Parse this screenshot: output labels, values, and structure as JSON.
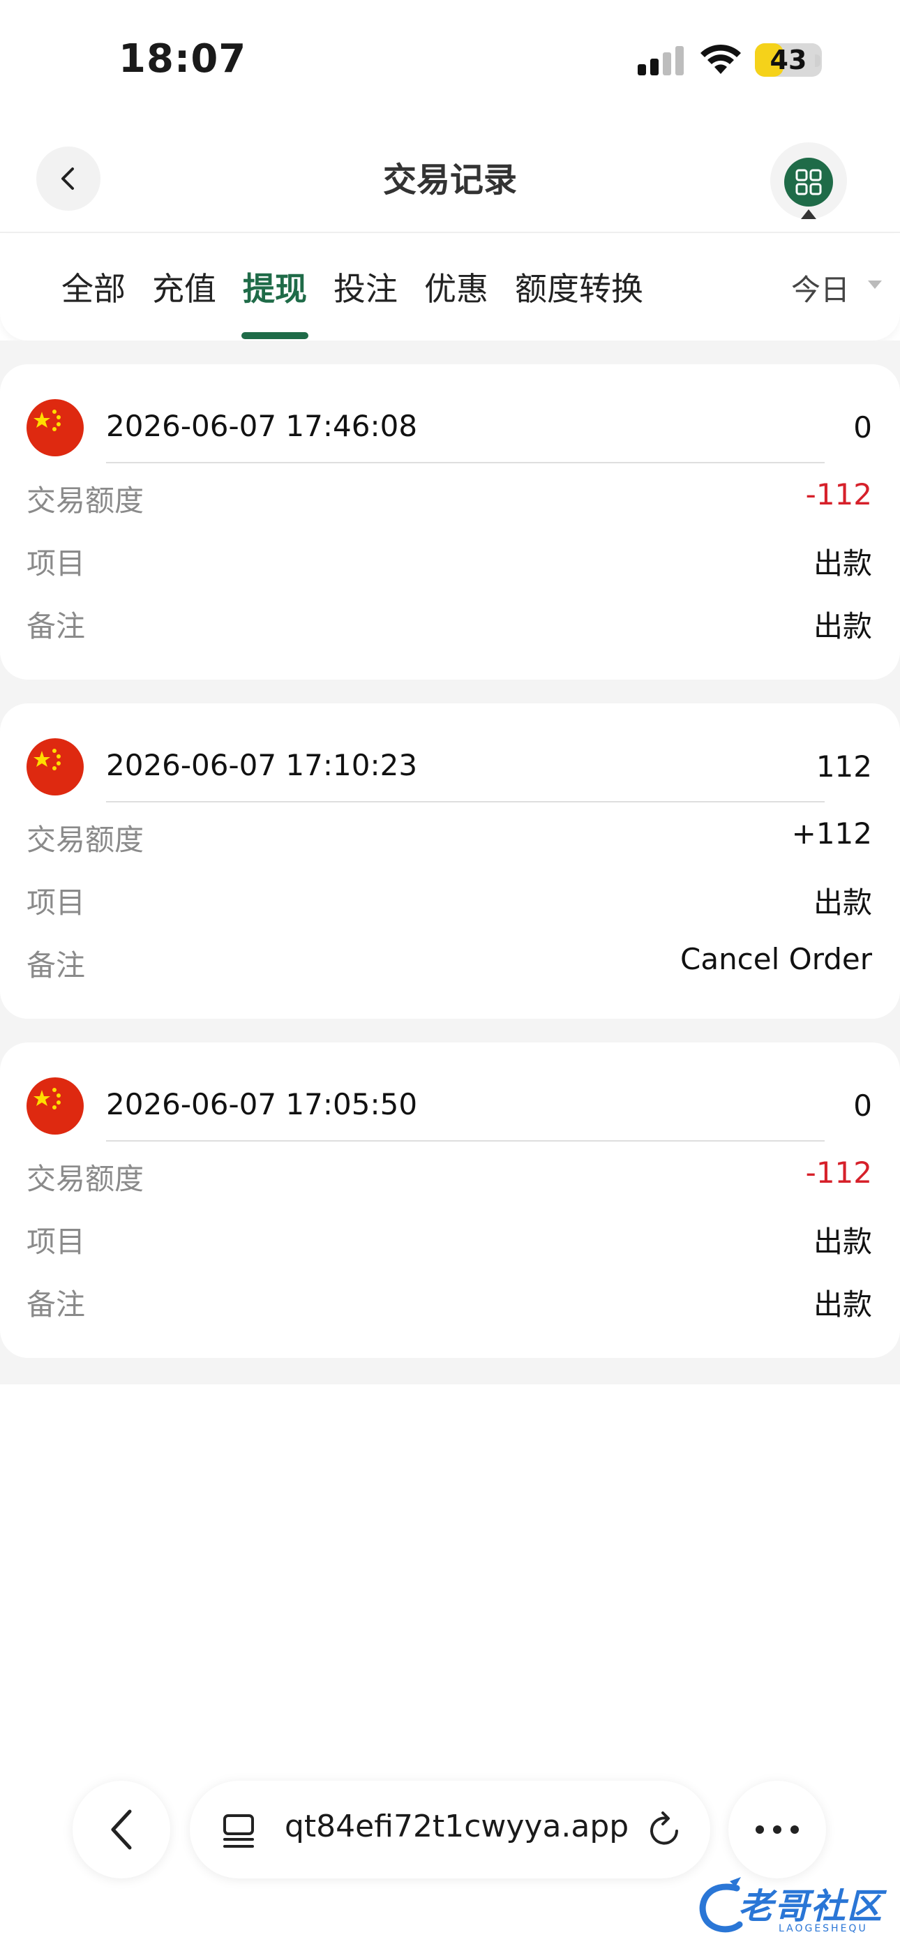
{
  "status_bar": {
    "time": "18:07",
    "battery": "43",
    "battery_level_percent": 43
  },
  "header": {
    "title": "交易记录",
    "back_icon": "chevron-left-icon",
    "menu_icon": "grid-icon"
  },
  "tabs": {
    "items": [
      {
        "label": "全部"
      },
      {
        "label": "充值"
      },
      {
        "label": "提现"
      },
      {
        "label": "投注"
      },
      {
        "label": "优惠"
      },
      {
        "label": "额度转换"
      }
    ],
    "active_index": 2,
    "date_filter": "今日"
  },
  "colors": {
    "accent": "#1f6b48",
    "negative": "#d6202a",
    "label_gray": "#8a8a8a"
  },
  "records": [
    {
      "time": "2026-06-07 17:46:08",
      "balance": "0",
      "amount_label": "交易额度",
      "amount": "-112",
      "item_label": "项目",
      "item": "出款",
      "note_label": "备注",
      "note": "出款"
    },
    {
      "time": "2026-06-07 17:10:23",
      "balance": "112",
      "amount_label": "交易额度",
      "amount": "+112",
      "item_label": "项目",
      "item": "出款",
      "note_label": "备注",
      "note": "Cancel Order"
    },
    {
      "time": "2026-06-07 17:05:50",
      "balance": "0",
      "amount_label": "交易额度",
      "amount": "-112",
      "item_label": "项目",
      "item": "出款",
      "note_label": "备注",
      "note": "出款"
    }
  ],
  "browser": {
    "url": "qt84efi72t1cwyya.app",
    "back_icon": "chevron-left-icon",
    "tabs_icon": "tabs-icon",
    "reload_icon": "reload-icon",
    "more_icon": "more-icon"
  },
  "watermark": {
    "text": "老哥社区",
    "sub": "LAOGESHEQU"
  }
}
